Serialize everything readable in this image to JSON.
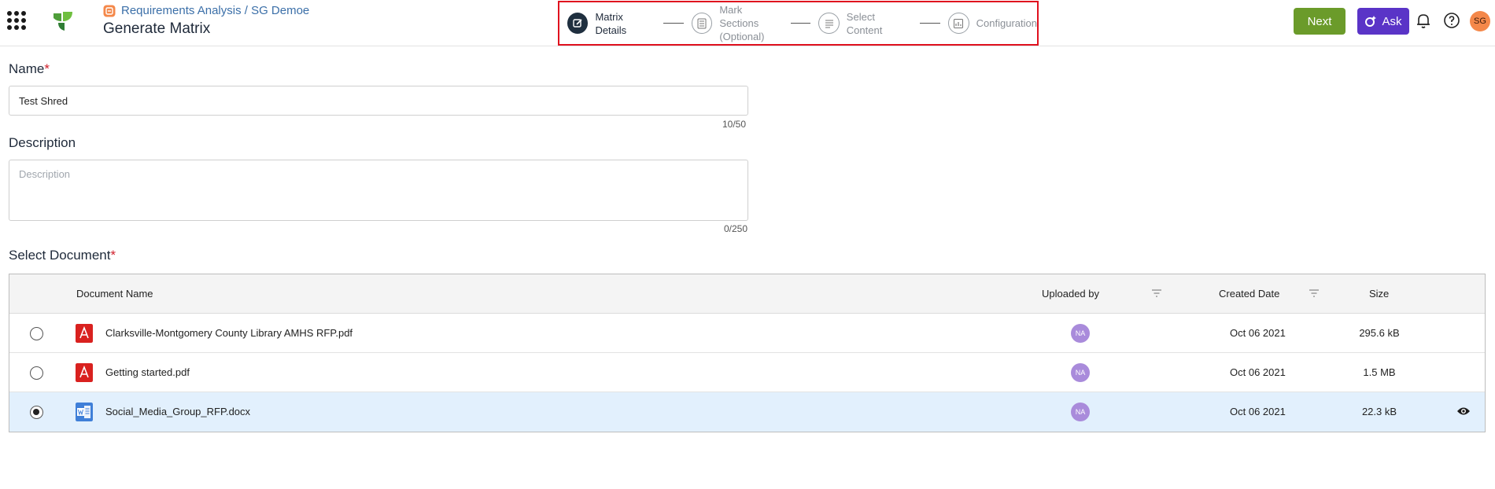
{
  "header": {
    "breadcrumb": "Requirements Analysis / SG Demoe",
    "title": "Generate Matrix",
    "next_label": "Next",
    "ask_label": "Ask",
    "user_initials": "SG"
  },
  "stepper": [
    {
      "label": "Matrix Details",
      "active": true,
      "icon": "edit-icon"
    },
    {
      "label": "Mark Sections",
      "sublabel": "(Optional)",
      "active": false,
      "icon": "document-list-icon"
    },
    {
      "label": "Select Content",
      "active": false,
      "icon": "text-lines-icon"
    },
    {
      "label": "Configuration",
      "active": false,
      "icon": "chart-config-icon"
    }
  ],
  "form": {
    "name_label": "Name",
    "name_required": "*",
    "name_value": "Test Shred",
    "name_counter": "10/50",
    "description_label": "Description",
    "description_placeholder": "Description",
    "description_counter": "0/250",
    "select_document_label": "Select Document",
    "select_document_required": "*"
  },
  "table": {
    "columns": {
      "document_name": "Document Name",
      "uploaded_by": "Uploaded by",
      "created_date": "Created Date",
      "size": "Size"
    },
    "rows": [
      {
        "name": "Clarksville-Montgomery County Library AMHS RFP.pdf",
        "type": "pdf",
        "uploaded_by": "NA",
        "created": "Oct 06 2021",
        "size": "295.6 kB",
        "selected": false
      },
      {
        "name": "Getting started.pdf",
        "type": "pdf",
        "uploaded_by": "NA",
        "created": "Oct 06 2021",
        "size": "1.5 MB",
        "selected": false
      },
      {
        "name": "Social_Media_Group_RFP.docx",
        "type": "docx",
        "uploaded_by": "NA",
        "created": "Oct 06 2021",
        "size": "22.3 kB",
        "selected": true
      }
    ]
  },
  "colors": {
    "next": "#6b9b2a",
    "ask": "#5a34c7",
    "avatar": "#f4884a",
    "na_avatar": "#a98bdb",
    "selected_row": "#e2f0fd",
    "stepper_highlight": "#e0101e"
  }
}
